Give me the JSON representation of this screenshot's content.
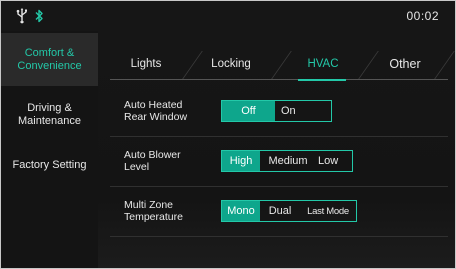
{
  "status_bar": {
    "clock": "00:02",
    "icons": [
      "usb-icon",
      "bluetooth-icon"
    ]
  },
  "sidebar": {
    "items": [
      {
        "label": "Comfort &\nConvenience",
        "active": true
      },
      {
        "label": "Driving &\nMaintenance",
        "active": false
      },
      {
        "label": "Factory Setting",
        "active": false
      }
    ]
  },
  "tabs": [
    {
      "label": "Lights",
      "active": false
    },
    {
      "label": "Locking",
      "active": false
    },
    {
      "label": "HVAC",
      "active": true
    },
    {
      "label": "Other",
      "active": false
    }
  ],
  "settings": [
    {
      "label": "Auto Heated\nRear Window",
      "options": [
        "Off",
        "On"
      ],
      "selected": "Off"
    },
    {
      "label": "Auto Blower\nLevel",
      "options": [
        "High",
        "Medium",
        "Low"
      ],
      "selected": "High"
    },
    {
      "label": "Multi Zone\nTemperature",
      "options": [
        "Mono",
        "Dual",
        "Last Mode"
      ],
      "selected": "Mono"
    }
  ],
  "colors": {
    "accent": "#23c8a8",
    "selected_fill": "#0ea68c",
    "background": "#141414",
    "text": "#e8e8e8"
  }
}
